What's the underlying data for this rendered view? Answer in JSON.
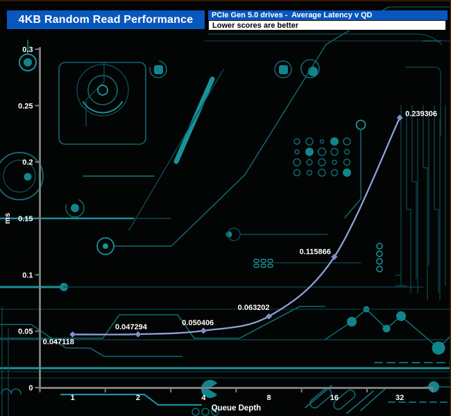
{
  "header": {
    "title": "4KB Random Read Performance",
    "subtitle": "PCIe Gen 5.0 drives -  Average Latency v QD",
    "note": "Lower scores are better",
    "accent_blue": "#0857bd"
  },
  "background": {
    "theme": "circuit-board",
    "trace_dim": "#0a4d54",
    "trace_mid": "#0e6b72",
    "trace_bright": "#17939b",
    "pad_fill": "#11858d"
  },
  "chart_data": {
    "type": "line",
    "title": "4KB Random Read Performance",
    "subtitle": "PCIe Gen 5.0 drives - Average Latency v QD",
    "note": "Lower scores are better",
    "categories": [
      "1",
      "2",
      "4",
      "8",
      "16",
      "32"
    ],
    "series": [
      {
        "name": "PCIe Gen 5.0 drive average latency",
        "values": [
          0.047118,
          0.047294,
          0.050406,
          0.063202,
          0.115866,
          0.239306
        ]
      }
    ],
    "point_labels": [
      "0.047118",
      "0.047294",
      "0.050406",
      "0.063202",
      "0.115866",
      "0.239306"
    ],
    "label_anchors": [
      {
        "anchor": "start",
        "dx": -43,
        "dy": 14
      },
      {
        "anchor": "middle",
        "dx": -10,
        "dy": -7
      },
      {
        "anchor": "middle",
        "dx": -8,
        "dy": -8
      },
      {
        "anchor": "end",
        "dx": 1,
        "dy": -9
      },
      {
        "anchor": "end",
        "dx": -5,
        "dy": -4
      },
      {
        "anchor": "start",
        "dx": 8,
        "dy": -2
      }
    ],
    "xlabel": "Queue Depth",
    "ylabel": "ms",
    "ylim": [
      0,
      0.3
    ],
    "ytick_step": 0.05,
    "yticks": [
      "0",
      "0.05",
      "0.1",
      "0.15",
      "0.2",
      "0.25",
      "0.3"
    ],
    "grid": false,
    "legend": "none",
    "line_color": "#8da2d8",
    "marker_color": "#7e90c8",
    "axis_color": "#7d7d7d",
    "label_color": "#ffffff"
  }
}
